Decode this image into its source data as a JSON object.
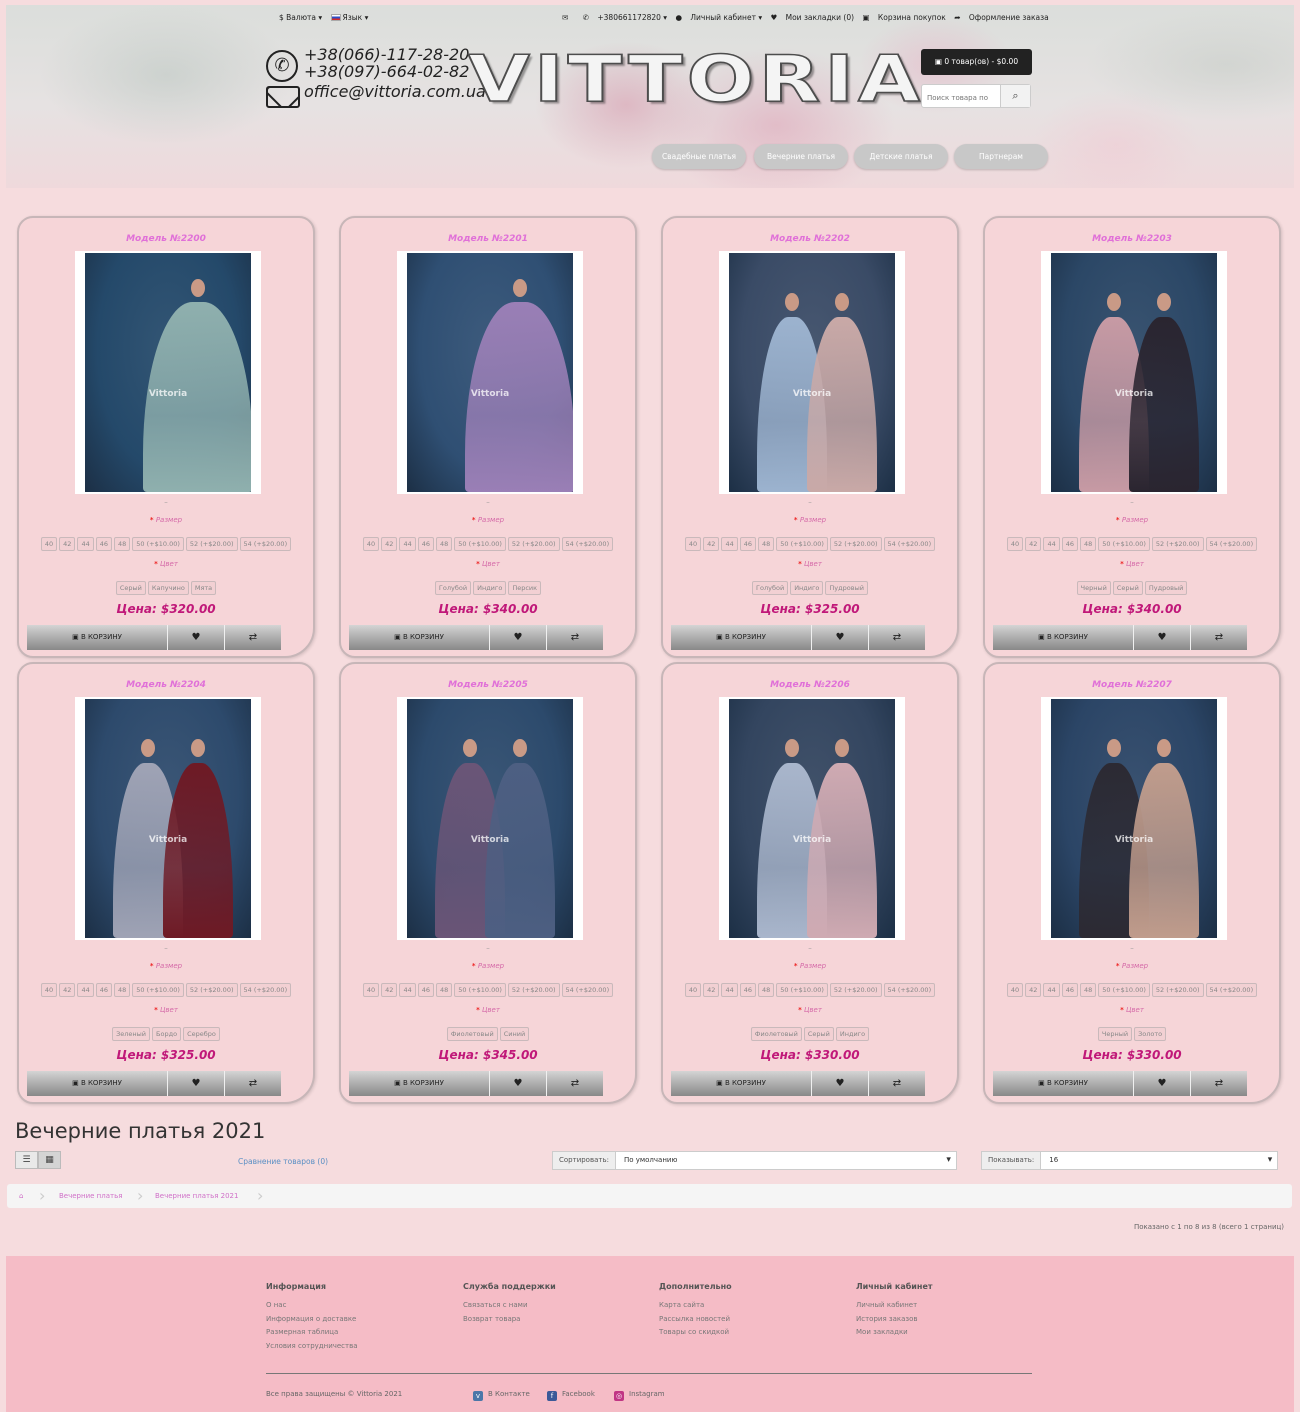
{
  "topbar": {
    "currency": "Валюта",
    "language": "Язык",
    "phone": "+380661172820",
    "account": "Личный кабинет",
    "wishlist": "Мои закладки (0)",
    "cart": "Корзина покупок",
    "checkout": "Оформление заказа"
  },
  "contact": {
    "phone1": "+38(066)-117-28-20",
    "phone2": "+38(097)-664-02-82",
    "email": "office@vittoria.com.ua"
  },
  "logo": "VITTORIA",
  "cart_button": "0 товар(ов) - $0.00",
  "search_placeholder": "Поиск товара по",
  "nav": [
    "Свадебные платья",
    "Вечерние платья",
    "Детские платья",
    "Партнерам"
  ],
  "labels": {
    "size": "Размер",
    "color": "Цвет",
    "add_to_cart": "В КОРЗИНУ",
    "dash": "–"
  },
  "sizes": [
    "40",
    "42",
    "44",
    "46",
    "48",
    "50 (+$10.00)",
    "52 (+$20.00)",
    "54 (+$20.00)"
  ],
  "products": [
    {
      "title": "Модель №2200",
      "colors": [
        "Серый",
        "Капучино",
        "Мята"
      ],
      "price": "Цена: $320.00",
      "watermark": "Vittoria"
    },
    {
      "title": "Модель №2201",
      "colors": [
        "Голубой",
        "Индиго",
        "Персик"
      ],
      "price": "Цена: $340.00",
      "watermark": "Vittoria"
    },
    {
      "title": "Модель №2202",
      "colors": [
        "Голубой",
        "Индиго",
        "Пудровый"
      ],
      "price": "Цена: $325.00",
      "watermark": "Vittoria"
    },
    {
      "title": "Модель №2203",
      "colors": [
        "Черный",
        "Серый",
        "Пудровый"
      ],
      "price": "Цена: $340.00",
      "watermark": "Vittoria"
    },
    {
      "title": "Модель №2204",
      "colors": [
        "Зеленый",
        "Бордо",
        "Серебро"
      ],
      "price": "Цена: $325.00",
      "watermark": "Vittoria"
    },
    {
      "title": "Модель №2205",
      "colors": [
        "Фиолетовый",
        "Синий"
      ],
      "price": "Цена: $345.00",
      "watermark": "Vittoria"
    },
    {
      "title": "Модель №2206",
      "colors": [
        "Фиолетовый",
        "Серый",
        "Индиго"
      ],
      "price": "Цена: $330.00",
      "watermark": "Vittoria"
    },
    {
      "title": "Модель №2207",
      "colors": [
        "Черный",
        "Золото"
      ],
      "price": "Цена: $330.00",
      "watermark": "Vittoria"
    }
  ],
  "category": {
    "title": "Вечерние платья 2021",
    "compare": "Сравнение товаров (0)",
    "sort_label": "Сортировать:",
    "sort_value": "По умолчанию",
    "limit_label": "Показывать:",
    "limit_value": "16",
    "breadcrumb": [
      "Вечерние платья",
      "Вечерние платья 2021"
    ],
    "shown": "Показано с 1 по 8 из 8 (всего 1 страниц)"
  },
  "footer": {
    "columns": [
      {
        "title": "Информация",
        "links": [
          "О нас",
          "Информация о доставке",
          "Размерная таблица",
          "Условия сотрудничества"
        ]
      },
      {
        "title": "Служба поддержки",
        "links": [
          "Связаться с нами",
          "Возврат товара"
        ]
      },
      {
        "title": "Дополнительно",
        "links": [
          "Карта сайта",
          "Рассылка новостей",
          "Товары со скидкой"
        ]
      },
      {
        "title": "Личный кабинет",
        "links": [
          "Личный кабинет",
          "История заказов",
          "Мои закладки"
        ]
      }
    ],
    "copyright": "Все права защищены © Vittoria 2021",
    "social": [
      "В Контакте",
      "Facebook",
      "Instagram"
    ]
  },
  "colors": {
    "accent": "#c01879",
    "title_pink": "#e070d8",
    "page_bg": "#f6dcde",
    "footer_bg": "#f5bcc6"
  }
}
